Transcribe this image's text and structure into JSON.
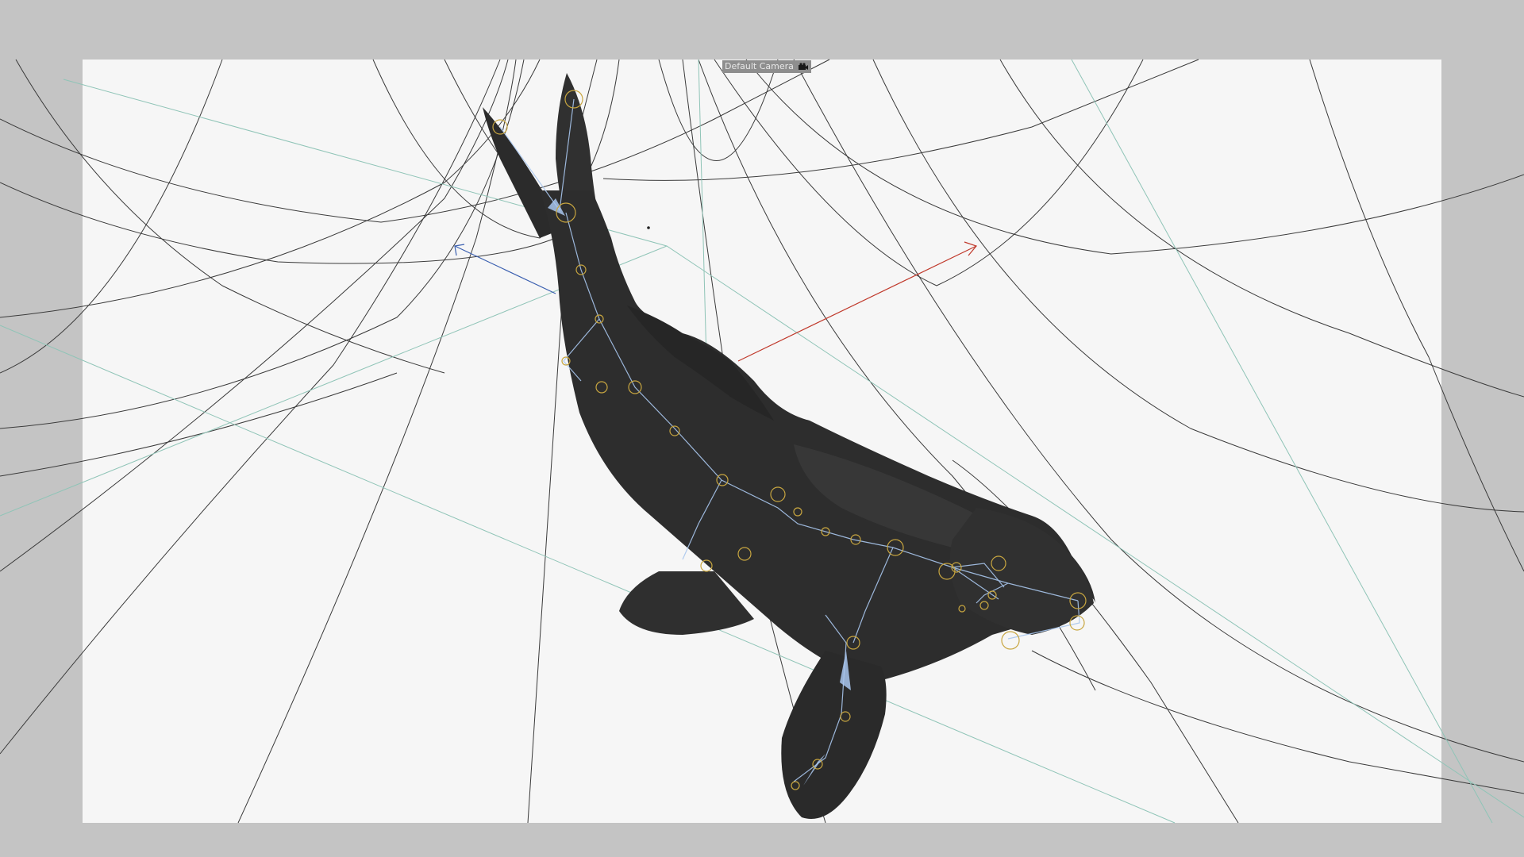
{
  "viewport": {
    "camera_label": "Default Camera",
    "camera_icon": "camera-icon",
    "frame_background": "#f6f6f6",
    "outside_background": "#c4c4c4"
  },
  "scene": {
    "model": "sea-lion-mesh",
    "model_color": "#2a2a2a",
    "joint_color": "#c8a640",
    "bone_color": "#a9c7ee",
    "x_axis_color": "#c0392b",
    "y_axis_color": "#3aa06a",
    "z_axis_color": "#3a5fb0"
  }
}
